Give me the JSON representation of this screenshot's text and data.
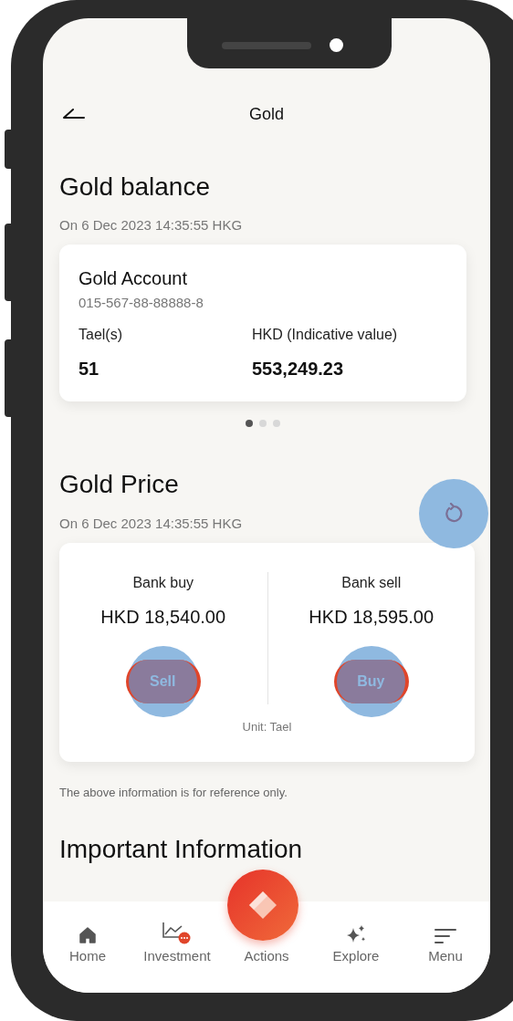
{
  "header": {
    "title": "Gold"
  },
  "balance": {
    "heading": "Gold balance",
    "timestamp": "On 6 Dec 2023 14:35:55 HKG",
    "account": {
      "name": "Gold Account",
      "number": "015-567-88-88888-8",
      "columns": [
        {
          "label": "Tael(s)",
          "value": "51"
        },
        {
          "label": "HKD (Indicative value)",
          "value": "553,249.23"
        }
      ]
    },
    "pages": [
      {
        "selected": true
      },
      {
        "selected": false
      },
      {
        "selected": false
      }
    ]
  },
  "price": {
    "heading": "Gold Price",
    "timestamp": "On 6 Dec 2023 14:35:55 HKG",
    "quotes": [
      {
        "label": "Bank buy",
        "price": "HKD 18,540.00",
        "action": "Sell"
      },
      {
        "label": "Bank sell",
        "price": "HKD 18,595.00",
        "action": "Buy"
      }
    ],
    "unit": "Unit: Tael"
  },
  "note": "The above information is for reference only.",
  "important_heading": "Important Information",
  "nav": [
    {
      "kind": "home",
      "label": "Home"
    },
    {
      "kind": "investment",
      "label": "Investment"
    },
    {
      "kind": "actions",
      "label": "Actions"
    },
    {
      "kind": "explore",
      "label": "Explore"
    },
    {
      "kind": "menu",
      "label": "Menu"
    }
  ]
}
